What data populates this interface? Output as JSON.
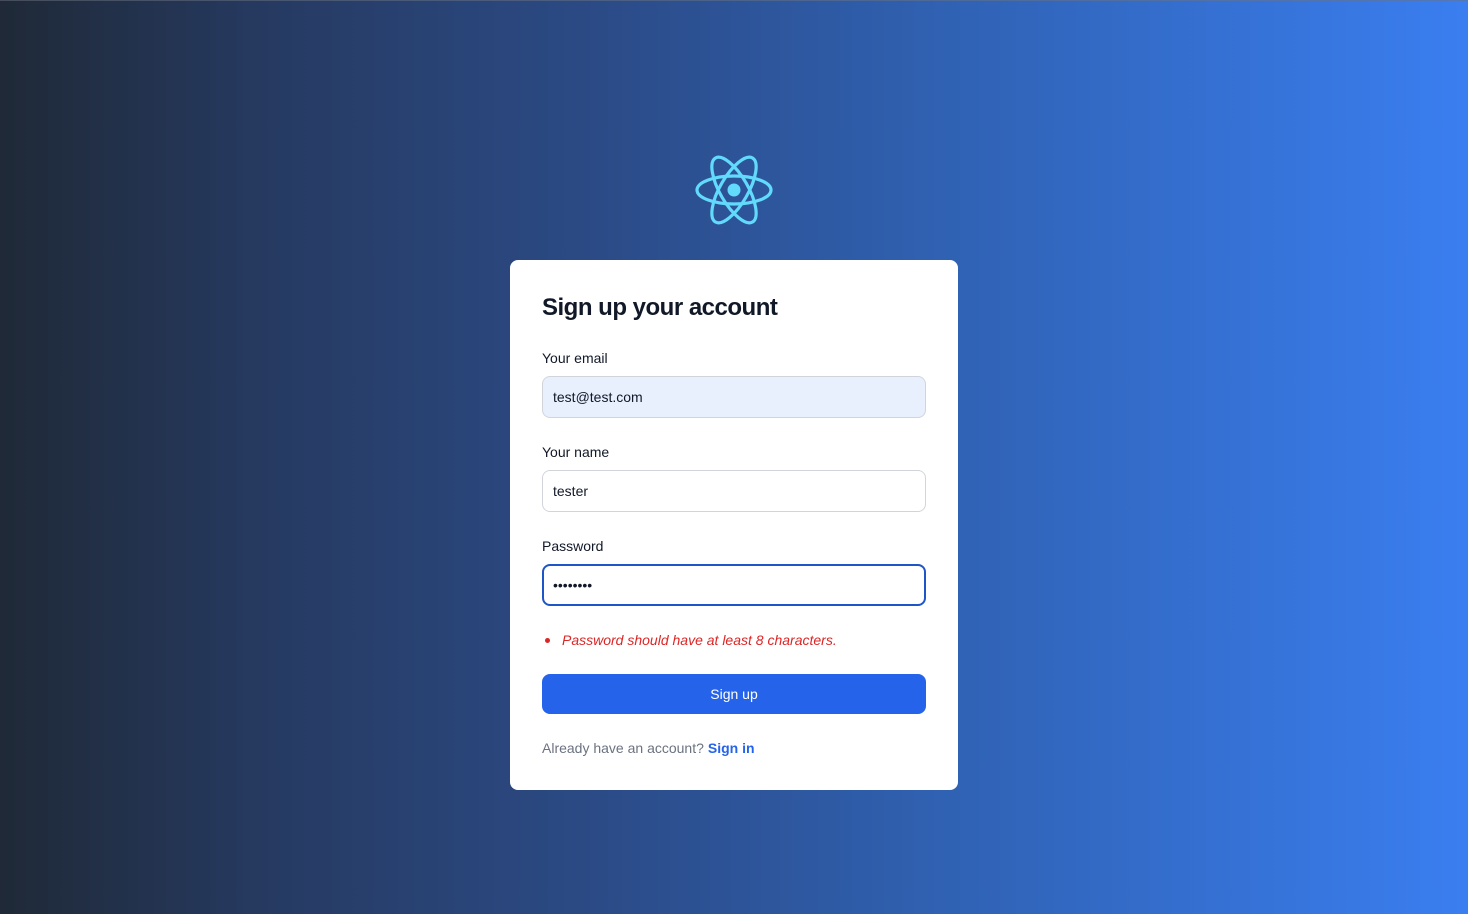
{
  "logo": {
    "icon": "react-atom-icon",
    "color": "#61dafb"
  },
  "form": {
    "title": "Sign up your account",
    "email": {
      "label": "Your email",
      "value": "test@test.com"
    },
    "name": {
      "label": "Your name",
      "value": "tester"
    },
    "password": {
      "label": "Password",
      "value": "12345678"
    },
    "error": "Password should have at least 8 characters.",
    "submit_label": "Sign up",
    "footer_text": "Already have an account?",
    "footer_link": "Sign in"
  },
  "colors": {
    "accent": "#2563eb",
    "error": "#dc2626",
    "autofill": "#e8f0fe"
  }
}
